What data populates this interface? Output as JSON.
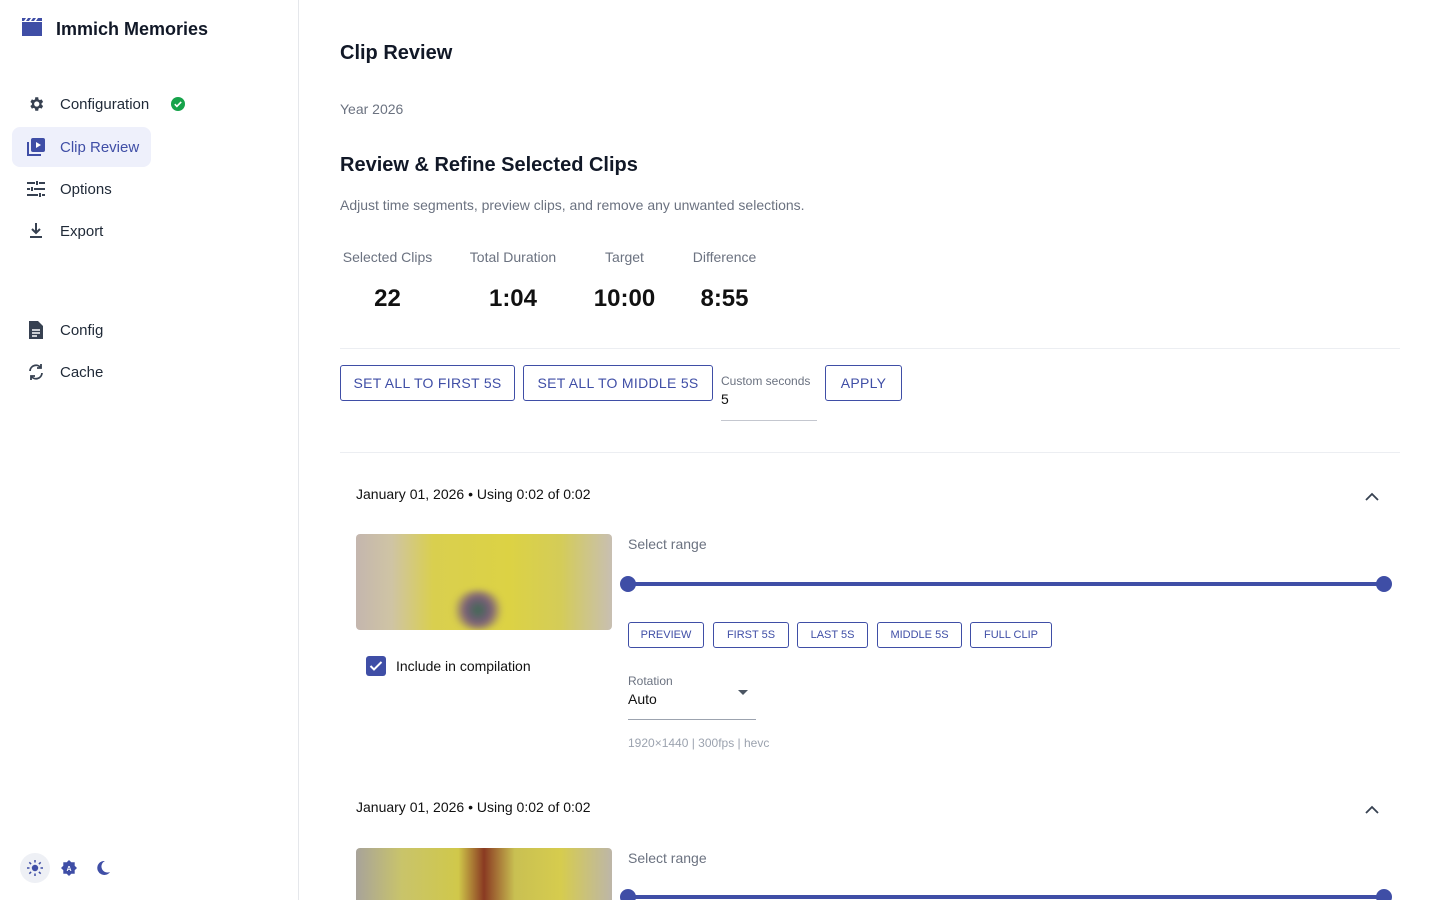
{
  "app": {
    "title": "Immich Memories"
  },
  "sidebar": {
    "items": [
      {
        "label": "Configuration",
        "icon": "gear-icon",
        "status": "complete"
      },
      {
        "label": "Clip Review",
        "icon": "clip-review-icon",
        "active": true
      },
      {
        "label": "Options",
        "icon": "sliders-icon"
      },
      {
        "label": "Export",
        "icon": "download-icon"
      }
    ],
    "secondary": [
      {
        "label": "Config",
        "icon": "document-icon"
      },
      {
        "label": "Cache",
        "icon": "refresh-icon"
      }
    ],
    "theme": [
      {
        "name": "light",
        "icon": "sun-icon",
        "active": true
      },
      {
        "name": "auto",
        "icon": "auto-brightness-icon"
      },
      {
        "name": "dark",
        "icon": "moon-icon"
      }
    ]
  },
  "page": {
    "title": "Clip Review",
    "year": "Year 2026",
    "section_title": "Review & Refine Selected Clips",
    "section_desc": "Adjust time segments, preview clips, and remove any unwanted selections."
  },
  "stats": [
    {
      "label": "Selected Clips",
      "value": "22"
    },
    {
      "label": "Total Duration",
      "value": "1:04"
    },
    {
      "label": "Target",
      "value": "10:00"
    },
    {
      "label": "Difference",
      "value": "8:55"
    }
  ],
  "bulk": {
    "first_label": "SET ALL TO FIRST 5S",
    "middle_label": "SET ALL TO MIDDLE 5S",
    "custom_label": "Custom seconds",
    "custom_value": "5",
    "apply_label": "APPLY"
  },
  "clips": [
    {
      "header": "January 01, 2026 • Using 0:02 of 0:02",
      "range_label": "Select range",
      "range": [
        0,
        1
      ],
      "buttons": [
        "PREVIEW",
        "FIRST 5S",
        "LAST 5S",
        "MIDDLE 5S",
        "FULL CLIP"
      ],
      "include_label": "Include in compilation",
      "included": true,
      "rotation_label": "Rotation",
      "rotation_value": "Auto",
      "meta": "1920×1440 | 300fps | hevc"
    },
    {
      "header": "January 01, 2026 • Using 0:02 of 0:02",
      "range_label": "Select range",
      "range": [
        0,
        1
      ]
    }
  ],
  "colors": {
    "accent": "#3f4ea6",
    "success": "#16a34a"
  }
}
